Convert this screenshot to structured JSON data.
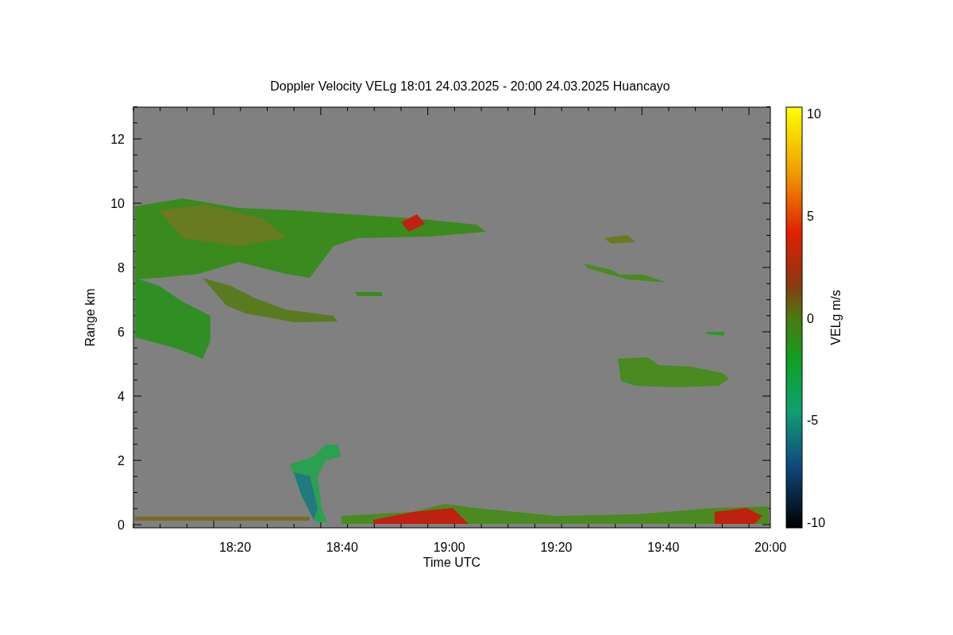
{
  "title": "Doppler Velocity VELg   18:01 24.03.2025 - 20:00 24.03.2025 Huancayo",
  "y_axis": {
    "label": "Range km",
    "ticks": [
      "12",
      "10",
      "8",
      "6",
      "4",
      "2",
      "0"
    ]
  },
  "x_axis": {
    "label": "Time UTC",
    "ticks": [
      "18:20",
      "18:40",
      "19:00",
      "19:20",
      "19:40",
      "20:00"
    ]
  },
  "colorbar": {
    "label": "VELg m/s",
    "ticks": [
      "10",
      "5",
      "0",
      "-5",
      "-10"
    ]
  }
}
